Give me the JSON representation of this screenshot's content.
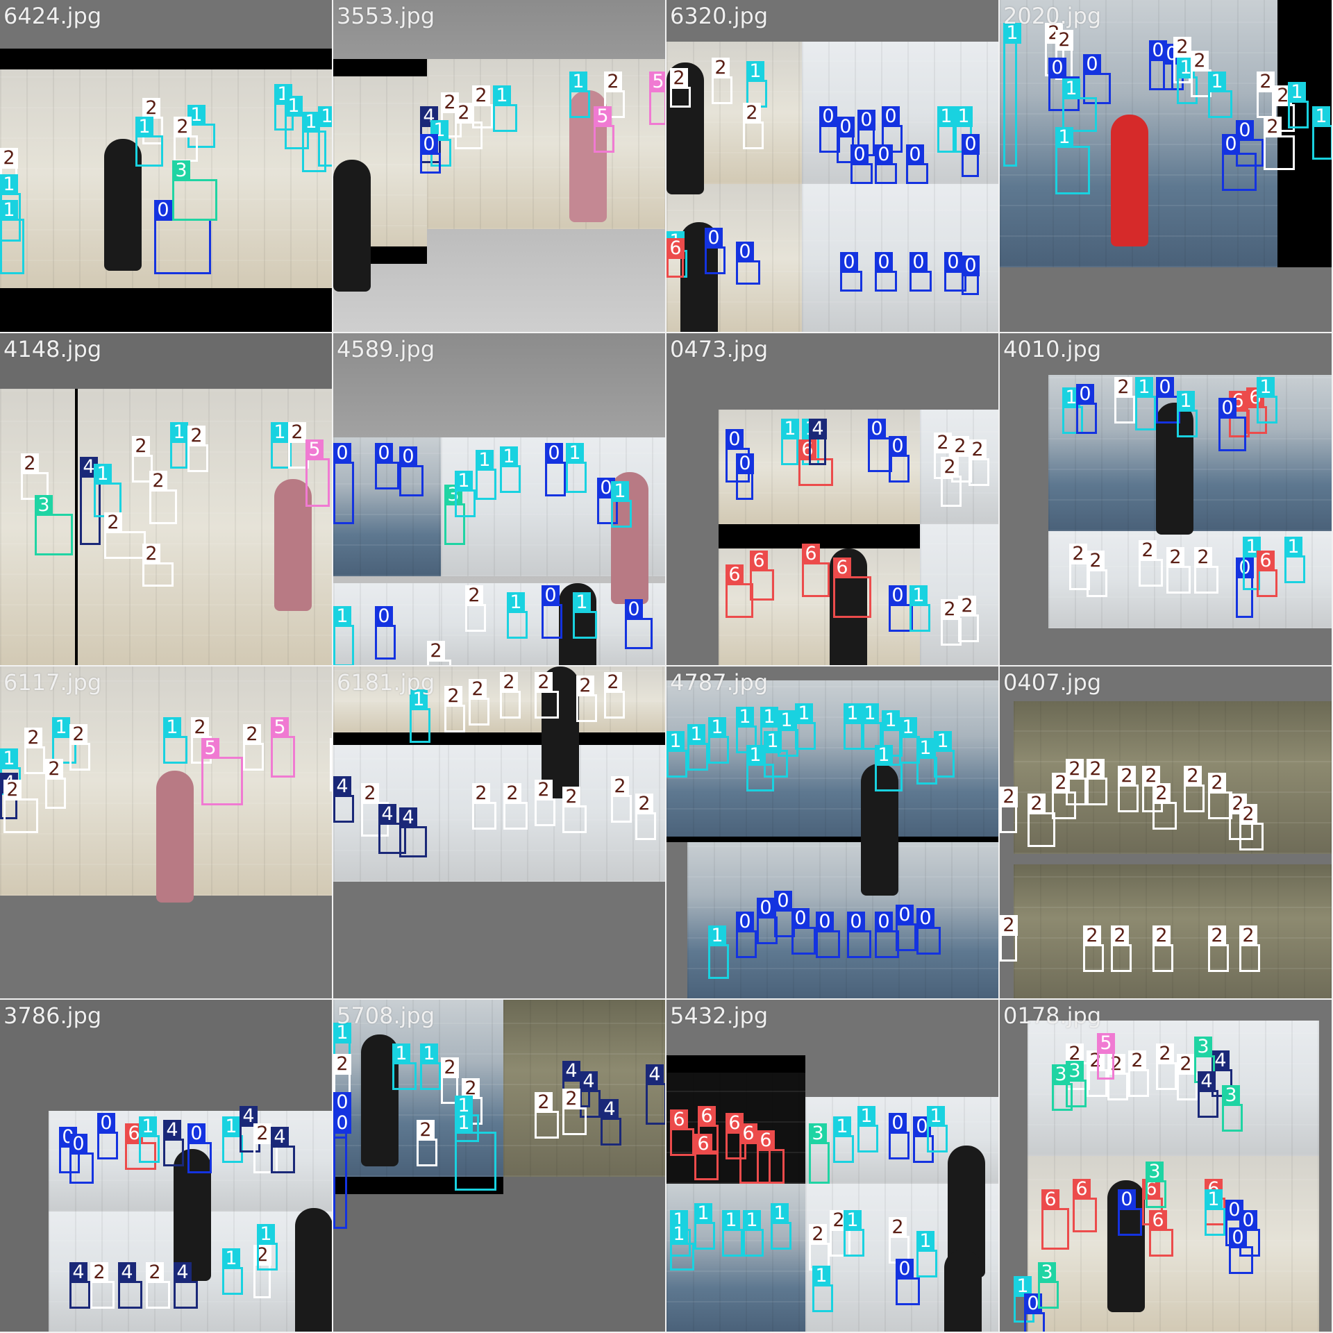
{
  "class_colors": {
    "0": "#1433e0",
    "1": "#19d2e0",
    "2": "#ffffff",
    "3": "#1fd4a3",
    "4": "#1a2878",
    "5": "#f07ad2",
    "6": "#ec4b4b"
  },
  "label_text_colors": {
    "2": "#5a1e14"
  },
  "tiles": [
    {
      "name": "6424.jpg"
    },
    {
      "name": "3553.jpg"
    },
    {
      "name": "6320.jpg"
    },
    {
      "name": "2020.jpg"
    },
    {
      "name": "4148.jpg"
    },
    {
      "name": "4589.jpg"
    },
    {
      "name": "0473.jpg"
    },
    {
      "name": "4010.jpg"
    },
    {
      "name": "6117.jpg"
    },
    {
      "name": "6181.jpg"
    },
    {
      "name": "4787.jpg"
    },
    {
      "name": "0407.jpg"
    },
    {
      "name": "3786.jpg"
    },
    {
      "name": "5708.jpg"
    },
    {
      "name": "5432.jpg"
    },
    {
      "name": "0178.jpg"
    }
  ]
}
